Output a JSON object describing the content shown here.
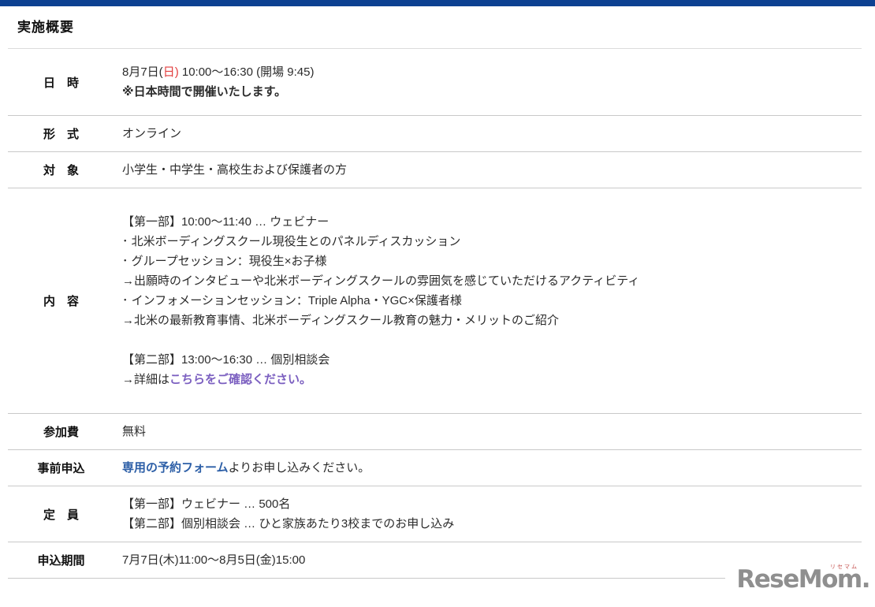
{
  "header": {
    "title": "実施概要"
  },
  "colors": {
    "topbar_navy": "#0d4191",
    "date_red": "#e23d3d",
    "link_blue": "#2d5fa7",
    "link_purple": "#7b5fc0",
    "row_border": "#c9c9c9",
    "logo_gray": "#8f8f8f"
  },
  "overview": {
    "rows": {
      "datetime": {
        "label": "日　時",
        "date_pre": "8月7日(",
        "date_red": "日)",
        "date_post": " 10:00〜16:30 (開場 9:45)",
        "note": "※日本時間で開催いたします。"
      },
      "format": {
        "label": "形　式",
        "value": "オンライン"
      },
      "audience": {
        "label": "対　象",
        "value": "小学生・中学生・高校生および保護者の方"
      },
      "content": {
        "label": "内　容",
        "part1_heading": "【第一部】10:00〜11:40 … ウェビナー",
        "part1_lines": [
          "･ 北米ボーディングスクール現役生とのパネルディスカッション",
          "･ グループセッション：現役生×お子様",
          "→出願時のインタビューや北米ボーディングスクールの雰囲気を感じていただけるアクティビティ",
          "･ インフォメーションセッション：Triple Alpha・YGC×保護者様",
          "→北米の最新教育事情、北米ボーディングスクール教育の魅力・メリットのご紹介"
        ],
        "part2_heading": "【第二部】13:00〜16:30 … 個別相談会",
        "detail_pre": "→詳細は",
        "detail_link": "こちらをご確認ください。"
      },
      "fee": {
        "label": "参加費",
        "value": "無料"
      },
      "application": {
        "label": "事前申込",
        "link": "専用の予約フォーム",
        "post": "よりお申し込みください。"
      },
      "capacity": {
        "label": "定　員",
        "line1": "【第一部】ウェビナー … 500名",
        "line2": "【第二部】個別相談会 … ひと家族あたり3校までのお申し込み"
      },
      "period": {
        "label": "申込期間",
        "value": "7月7日(木)11:00〜8月5日(金)15:00"
      }
    }
  },
  "watermark": {
    "logo_text": "ReseMom",
    "logo_period": ".",
    "logo_ruby": "リセマム"
  }
}
